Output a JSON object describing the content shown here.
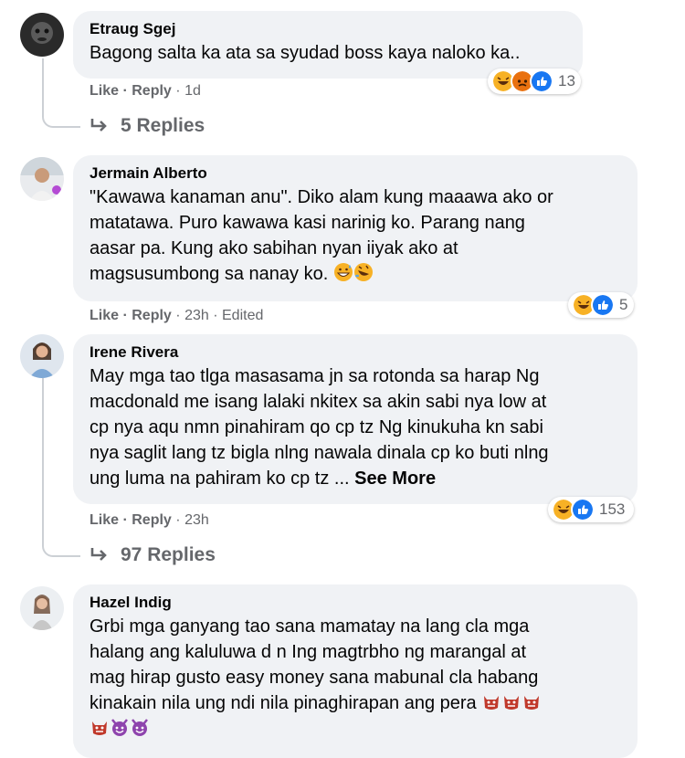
{
  "comments": [
    {
      "author": "Etraug Sgej",
      "text": "Bagong salta ka ata sa syudad boss kaya naloko ka..",
      "actions": {
        "like": "Like",
        "reply": "Reply",
        "time": "1d"
      },
      "reaction_icons": [
        "haha-icon",
        "angry-icon",
        "like-icon"
      ],
      "reaction_count": "13",
      "replies_label": "5 Replies"
    },
    {
      "author": "Jermain Alberto",
      "text_lines": [
        "\"Kawawa kanaman anu\". Diko alam kung maaawa ako or",
        "matatawa. Puro kawawa kasi narinig ko. Parang nang",
        "aasar pa. Kung ako sabihan nyan iiyak ako at",
        "magsusumbong sa nanay ko."
      ],
      "trailing_emojis": [
        "grinning-sweat-emoji",
        "rofl-emoji"
      ],
      "actions": {
        "like": "Like",
        "reply": "Reply",
        "time": "23h",
        "edited": "Edited"
      },
      "reaction_icons": [
        "haha-icon",
        "like-icon"
      ],
      "reaction_count": "5"
    },
    {
      "author": "Irene Rivera",
      "text_lines": [
        "May mga tao tlga masasama jn sa rotonda sa harap Ng",
        "macdonald me isang lalaki nkitex sa akin sabi nya low at",
        "cp nya aqu nmn pinahiram qo cp tz Ng kinukuha kn sabi",
        "nya saglit lang tz bigla nlng nawala dinala cp ko buti nlng",
        "ung luma na pahiram ko cp tz ..."
      ],
      "see_more": "See More",
      "actions": {
        "like": "Like",
        "reply": "Reply",
        "time": "23h"
      },
      "reaction_icons": [
        "haha-icon",
        "like-icon"
      ],
      "reaction_count": "153",
      "replies_label": "97 Replies"
    },
    {
      "author": "Hazel Indig",
      "text_lines": [
        "Grbi mga ganyang tao sana mamatay na lang cla mga",
        "halang ang kaluluwa d n Ing magtrbho ng marangal at",
        "mag hirap gusto easy money sana mabunal cla habang",
        "kinakain nila ung ndi nila pinaghirapan ang pera"
      ],
      "trailing_emojis": [
        "ogre-emoji",
        "ogre-emoji",
        "ogre-emoji",
        "ogre-emoji",
        "devil-emoji",
        "devil-emoji"
      ]
    }
  ],
  "colors": {
    "bubble": "#f0f2f5",
    "meta_text": "#65676b",
    "like_blue": "#1877f2",
    "haha_yellow": "#f7b125",
    "angry_orange": "#e9710f"
  }
}
